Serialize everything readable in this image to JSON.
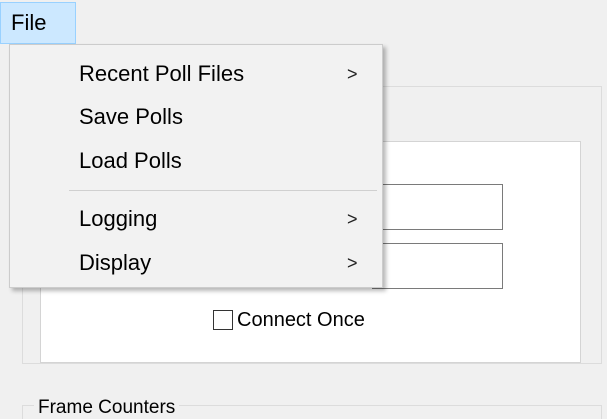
{
  "menubar": {
    "file_label": "File"
  },
  "dropdown": {
    "items": [
      {
        "label": "Recent Poll Files",
        "submenu_icon": "chevron-right-icon",
        "arrow": ">"
      },
      {
        "label": "Save Polls"
      },
      {
        "label": "Load Polls"
      },
      {
        "label": "Logging",
        "submenu_icon": "chevron-right-icon",
        "arrow": ">"
      },
      {
        "label": "Display",
        "submenu_icon": "chevron-right-icon",
        "arrow": ">"
      }
    ]
  },
  "form": {
    "connect_once_label": "Connect Once",
    "connect_once_checked": false
  },
  "frame_counters": {
    "label": "Frame Counters"
  }
}
